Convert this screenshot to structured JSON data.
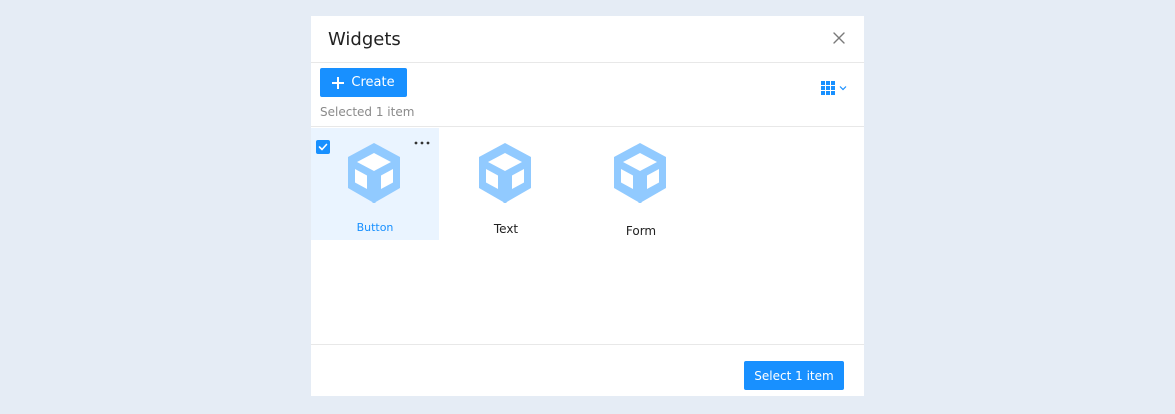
{
  "dialog": {
    "title": "Widgets",
    "close_icon": "close-icon"
  },
  "toolbar": {
    "create_label": "Create",
    "create_icon": "plus-icon",
    "selection_status": "Selected 1 item",
    "view_toggle_icon": "grid-icon",
    "view_toggle_chevron": "chevron-down-icon"
  },
  "widgets": [
    {
      "label": "Button",
      "selected": true,
      "icon": "cube-icon",
      "more_icon": "more-horizontal-icon"
    },
    {
      "label": "Text",
      "selected": false,
      "icon": "cube-icon"
    },
    {
      "label": "Form",
      "selected": false,
      "icon": "cube-icon"
    }
  ],
  "footer": {
    "select_label": "Select 1 item"
  },
  "colors": {
    "background": "#e5ecf5",
    "accent": "#1890ff",
    "selected_tile": "#eaf4ff",
    "icon": "#91caff"
  }
}
